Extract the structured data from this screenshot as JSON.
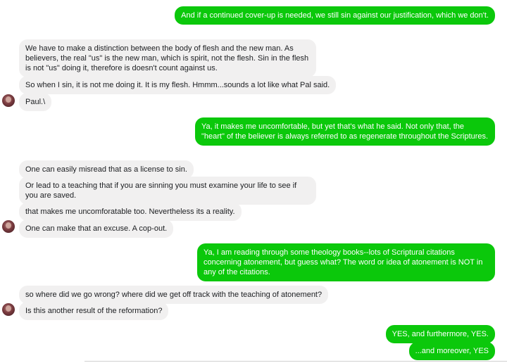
{
  "messages": [
    {
      "dir": "out",
      "text": "And if a continued cover-up is needed, we still sin against our justification, which we don't."
    },
    {
      "dir": "in",
      "text": "We have to make a distinction between the body of flesh and the new man.   As believers, the real \"us\" is the new man, which is spirit, not the flesh.  Sin in the flesh is not \"us\" doing it, therefore is doesn't count against us."
    },
    {
      "dir": "in",
      "text": "So when I sin, it is not me doing it.  It is my flesh.  Hmmm...sounds a lot like what Pal said."
    },
    {
      "dir": "in",
      "text": "Paul.\\"
    },
    {
      "dir": "out",
      "text": "Ya, it makes me uncomfortable, but yet that's what he said. Not only that, the \"heart\" of the believer is always referred to as regenerate throughout the Scriptures."
    },
    {
      "dir": "in",
      "text": "One can easily misread that as a license to sin."
    },
    {
      "dir": "in",
      "text": "Or lead to a teaching that if you are sinning you must examine your life to see if you are saved."
    },
    {
      "dir": "in",
      "text": "that makes me uncomforatable too.  Nevertheless its a reality."
    },
    {
      "dir": "in",
      "text": "One can make that an excuse.  A cop-out."
    },
    {
      "dir": "out",
      "text": "Ya, I am reading through some theology books--lots of Scriptural citations concerning atonement, but guess what? The word or idea of atonement is NOT in any of the citations."
    },
    {
      "dir": "in",
      "text": "so where did we go wrong?  where did we get off track with the teaching of atonement?"
    },
    {
      "dir": "in",
      "text": "Is this another result of the reformation?"
    },
    {
      "dir": "out",
      "text": "YES, and furthermore, YES."
    },
    {
      "dir": "out",
      "text": "...and moreover, YES"
    }
  ]
}
